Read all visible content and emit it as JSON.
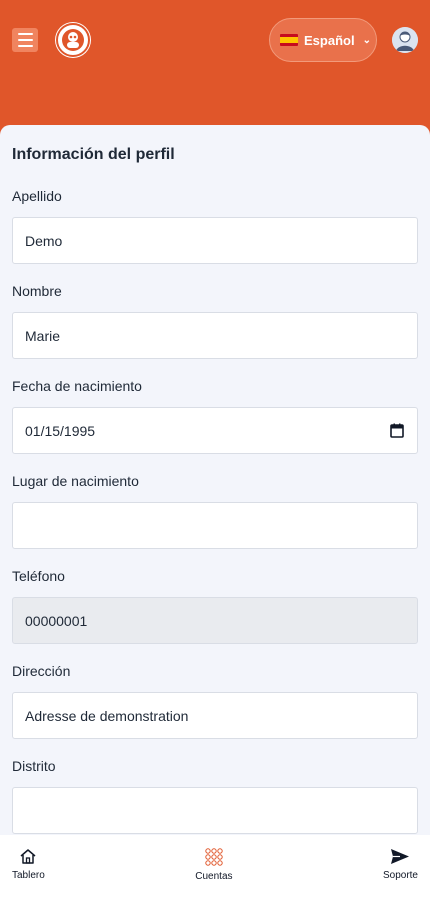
{
  "header": {
    "language_label": "Español",
    "colors": {
      "brand": "#e0562a",
      "background": "#f3f5fb"
    }
  },
  "profile": {
    "section_title": "Información del perfil",
    "fields": {
      "apellido": {
        "label": "Apellido",
        "value": "Demo"
      },
      "nombre": {
        "label": "Nombre",
        "value": "Marie"
      },
      "fecha_nacimiento": {
        "label": "Fecha de nacimiento",
        "value": "01/15/1995"
      },
      "lugar_nacimiento": {
        "label": "Lugar de nacimiento",
        "value": ""
      },
      "telefono": {
        "label": "Teléfono",
        "value": "00000001"
      },
      "direccion": {
        "label": "Dirección",
        "value": "Adresse de demonstration"
      },
      "distrito": {
        "label": "Distrito",
        "value": ""
      }
    }
  },
  "bottom_nav": {
    "items": [
      {
        "label": "Tablero",
        "icon": "home-icon"
      },
      {
        "label": "Cuentas",
        "icon": "accounts-grid-icon"
      },
      {
        "label": "Soporte",
        "icon": "send-icon"
      }
    ]
  }
}
